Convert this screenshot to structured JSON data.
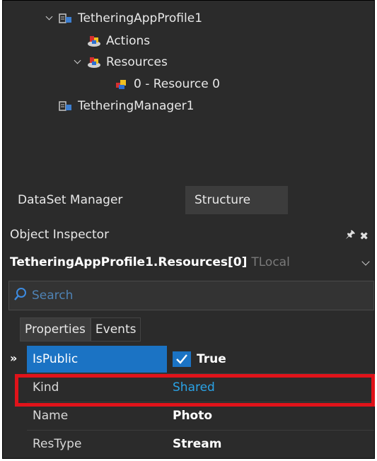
{
  "tree": {
    "nodes": [
      {
        "label": "TetheringAppProfile1",
        "icon": "component-icon",
        "expanded": true
      },
      {
        "label": "Actions",
        "icon": "collection-icon"
      },
      {
        "label": "Resources",
        "icon": "collection-icon",
        "expanded": true
      },
      {
        "label": "0 - Resource 0",
        "icon": "resource-item-icon"
      },
      {
        "label": "TetheringManager1",
        "icon": "component-icon"
      }
    ]
  },
  "tabs": {
    "dataset_manager": "DataSet Manager",
    "structure": "Structure"
  },
  "inspector": {
    "title": "Object Inspector",
    "selected_object": "TetheringAppProfile1.Resources[0]",
    "selected_class": "TLocal",
    "search_placeholder": "Search",
    "tab_properties": "Properties",
    "tab_events": "Events",
    "rows": [
      {
        "name": "IsPublic",
        "value": "True"
      },
      {
        "name": "Kind",
        "value": "Shared"
      },
      {
        "name": "Name",
        "value": "Photo"
      },
      {
        "name": "ResType",
        "value": "Stream"
      }
    ]
  },
  "colors": {
    "background": "#2b2b2b",
    "selection": "#1b73c4",
    "link_value": "#2aa3e6",
    "highlight_box": "#e0131a"
  }
}
